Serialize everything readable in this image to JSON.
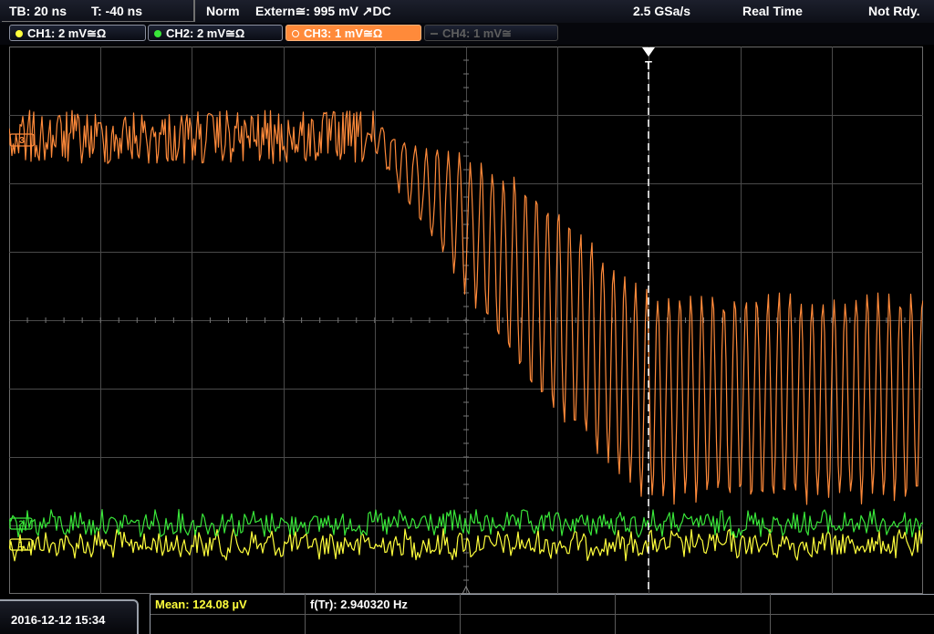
{
  "status_bar": {
    "timebase": "TB: 20 ns",
    "trigger_time": "T: -40 ns",
    "trigger_mode": "Norm",
    "trigger_source": "Extern≅: 995 mV ↗DC",
    "sample_rate": "2.5 GSa/s",
    "acquisition_mode": "Real Time",
    "run_state": "Not Rdy."
  },
  "channels": [
    {
      "label": "CH1: 2 mV≅Ω",
      "color": "#ffff3c",
      "state": "on"
    },
    {
      "label": "CH2: 2 mV≅Ω",
      "color": "#39e639",
      "state": "on"
    },
    {
      "label": "CH3: 1 mV≅Ω",
      "color": "#ff8a3a",
      "state": "active"
    },
    {
      "label": "CH4: 1 mV≅",
      "color": "#5e5e5e",
      "state": "off"
    }
  ],
  "markers": {
    "ch3_marker": "3",
    "ch2_marker": "2",
    "ch1_marker": "1",
    "trigger_marker": "T"
  },
  "bottom_bar": {
    "datetime": "2016-12-12 15:34",
    "measurement_mean": "Mean: 124.08 µV",
    "measurement_freq": "f(Tr): 2.940320 Hz"
  },
  "colors": {
    "ch1": "#ffff3c",
    "ch2": "#39e639",
    "ch3": "#ff8a3a",
    "grid": "#4a4a4a",
    "trigger_line": "#ffffff"
  }
}
